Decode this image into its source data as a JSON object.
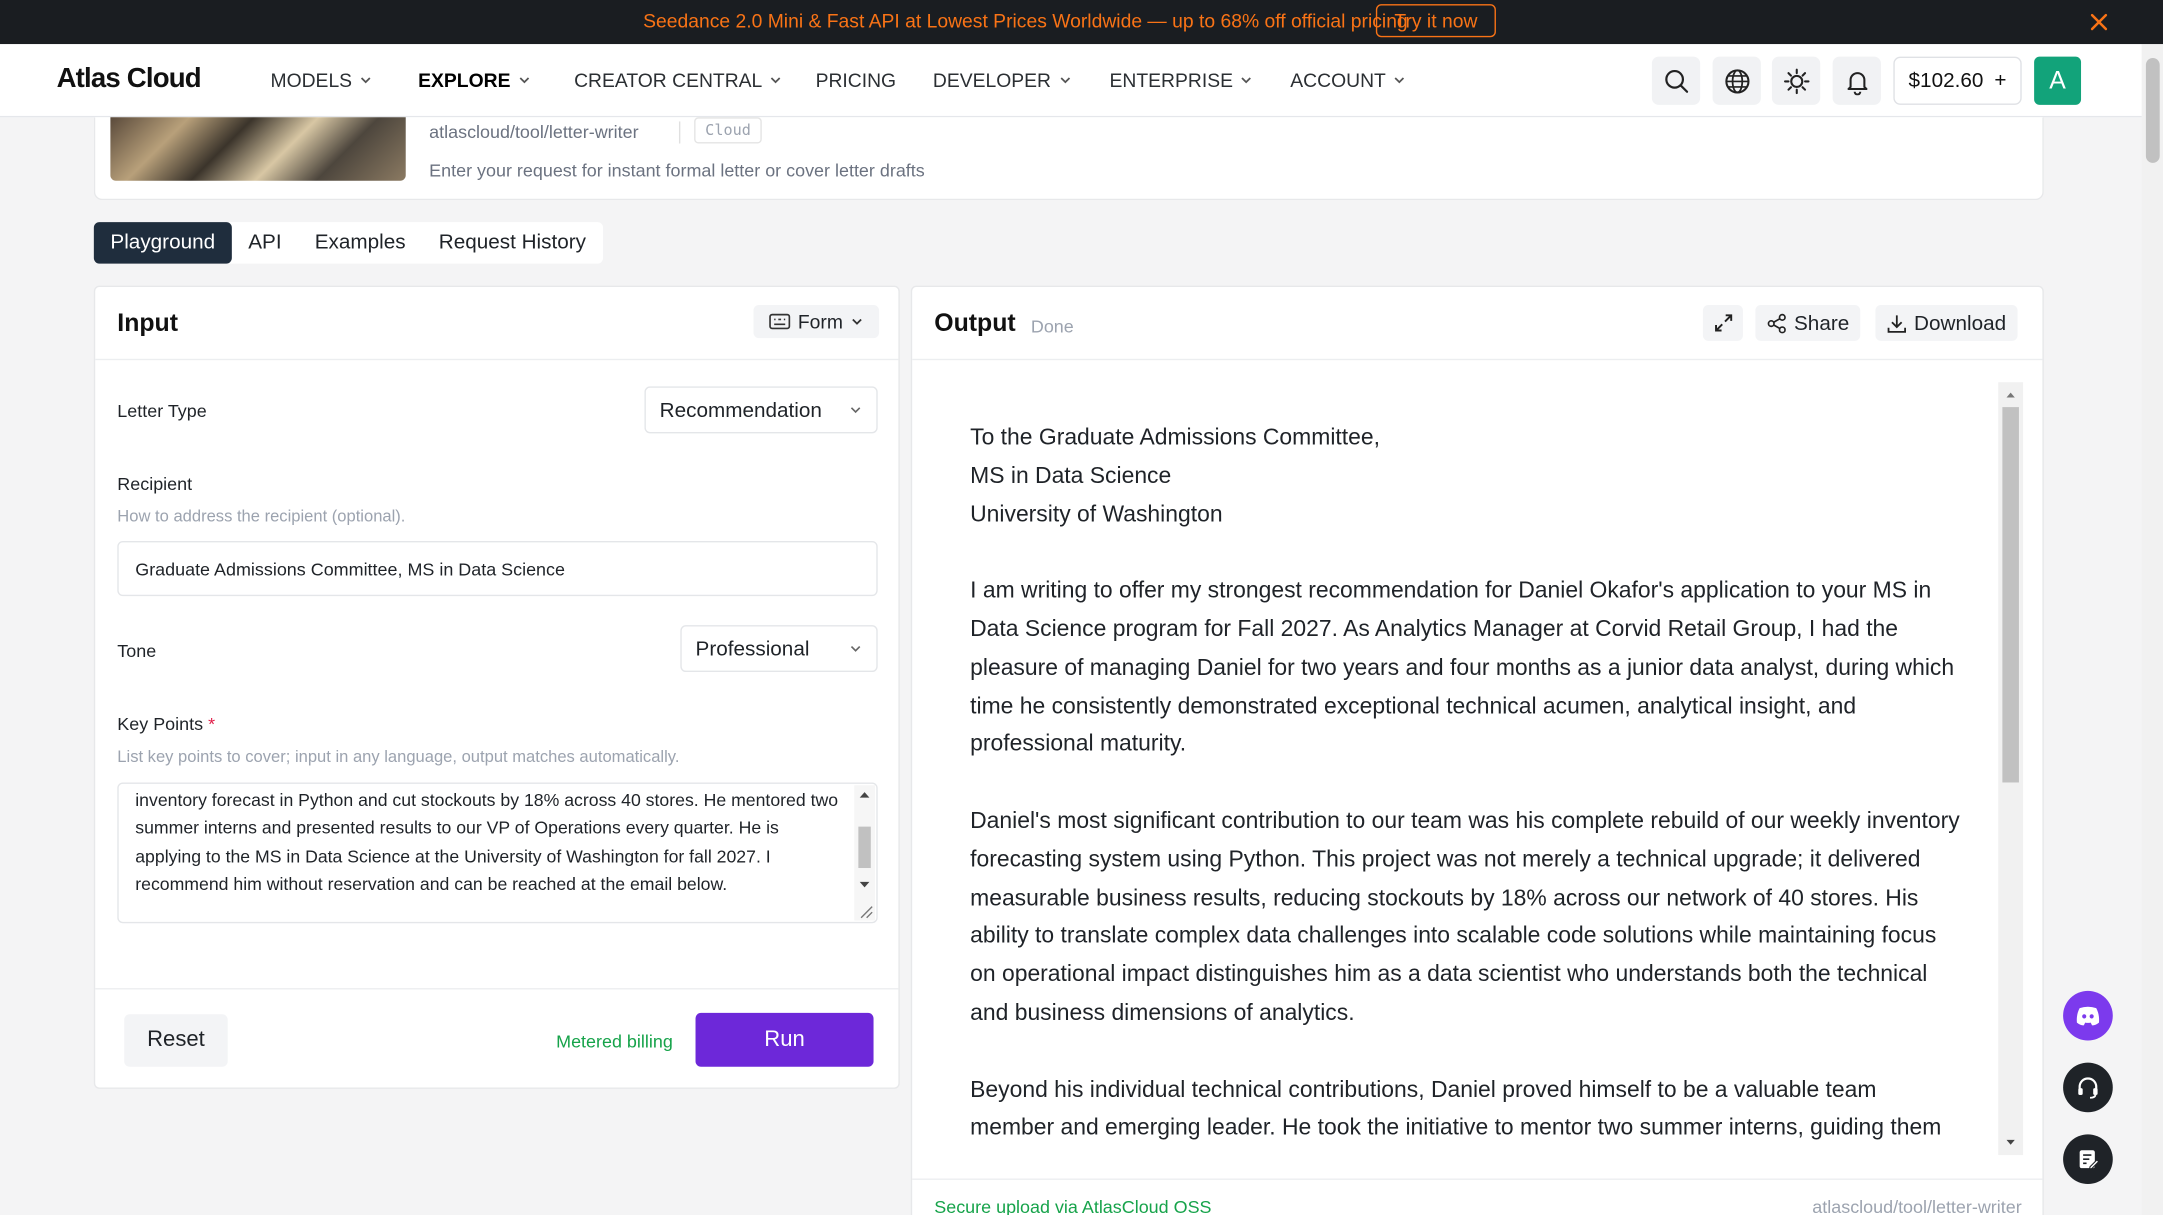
{
  "banner": {
    "text": "Seedance 2.0 Mini & Fast API at Lowest Prices Worldwide — up to 68% off official pricing",
    "cta": "Try it now",
    "close_icon": "close-icon"
  },
  "nav": {
    "logo": "Atlas Cloud",
    "items": [
      {
        "label": "MODELS",
        "dropdown": true
      },
      {
        "label": "EXPLORE",
        "dropdown": true,
        "active": true
      },
      {
        "label": "CREATOR CENTRAL",
        "dropdown": true
      },
      {
        "label": "PRICING",
        "dropdown": false
      },
      {
        "label": "DEVELOPER",
        "dropdown": true
      },
      {
        "label": "ENTERPRISE",
        "dropdown": true
      },
      {
        "label": "ACCOUNT",
        "dropdown": true
      }
    ],
    "icons": [
      "search-icon",
      "globe-icon",
      "sun-icon",
      "bell-icon"
    ],
    "balance": "$102.60",
    "balance_add": "+",
    "avatar_letter": "A",
    "avatar_color": "#12a37a"
  },
  "model": {
    "path": "atlascloud/tool/letter-writer",
    "tag": "Cloud",
    "description": "Enter your request for instant formal letter or cover letter drafts"
  },
  "tabs": [
    {
      "label": "Playground",
      "active": true
    },
    {
      "label": "API"
    },
    {
      "label": "Examples"
    },
    {
      "label": "Request History"
    }
  ],
  "input": {
    "title": "Input",
    "mode": "Form",
    "letter_type": {
      "label": "Letter Type",
      "value": "Recommendation"
    },
    "recipient": {
      "label": "Recipient",
      "hint": "How to address the recipient (optional).",
      "value": "Graduate Admissions Committee, MS in Data Science"
    },
    "tone": {
      "label": "Tone",
      "value": "Professional"
    },
    "key_points": {
      "label": "Key Points",
      "required_mark": "*",
      "hint": "List key points to cover; input in any language, output matches automatically.",
      "value": "inventory forecast in Python and cut stockouts by 18% across 40 stores. He mentored two summer interns and presented results to our VP of Operations every quarter. He is applying to the MS in Data Science at the University of Washington for fall 2027. I recommend him without reservation and can be reached at the email below."
    },
    "reset_label": "Reset",
    "billing_label": "Metered billing",
    "run_label": "Run",
    "accent_color": "#6d28d9"
  },
  "output": {
    "title": "Output",
    "status": "Done",
    "share_label": "Share",
    "download_label": "Download",
    "address_lines": [
      "To the Graduate Admissions Committee,",
      "MS in Data Science",
      "University of Washington"
    ],
    "paragraphs": [
      "I am writing to offer my strongest recommendation for Daniel Okafor's application to your MS in Data Science program for Fall 2027. As Analytics Manager at Corvid Retail Group, I had the pleasure of managing Daniel for two years and four months as a junior data analyst, during which time he consistently demonstrated exceptional technical acumen, analytical insight, and professional maturity.",
      "Daniel's most significant contribution to our team was his complete rebuild of our weekly inventory forecasting system using Python. This project was not merely a technical upgrade; it delivered measurable business results, reducing stockouts by 18% across our network of 40 stores. His ability to translate complex data challenges into scalable code solutions while maintaining focus on operational impact distinguishes him as a data scientist who understands both the technical and business dimensions of analytics.",
      "Beyond his individual technical contributions, Daniel proved himself to be a valuable team member and emerging leader. He took the initiative to mentor two summer interns, guiding them"
    ],
    "footer_left": "Secure upload via AtlasCloud OSS",
    "footer_right": "atlascloud/tool/letter-writer"
  },
  "floating": [
    "discord-icon",
    "headset-icon",
    "feedback-icon"
  ]
}
